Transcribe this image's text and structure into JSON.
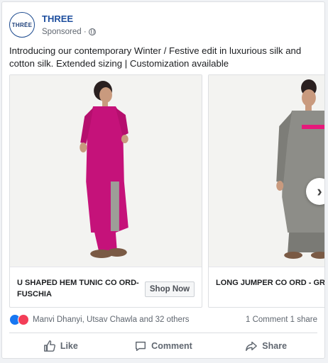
{
  "page": {
    "name": "THREE",
    "avatar_text": "THRĒE",
    "sponsored": "Sponsored ·"
  },
  "post": {
    "text": "Introducing our contemporary Winter / Festive edit in luxurious silk and cotton silk. Extended sizing | Customization available"
  },
  "carousel": {
    "items": [
      {
        "title": "U SHAPED HEM TUNIC CO ORD-FUSCHIA",
        "cta": "Shop Now",
        "dress_color": "#c5127a"
      },
      {
        "title": "LONG JUMPER CO ORD - GREY",
        "dress_color": "#8a8a85"
      }
    ],
    "next": "›"
  },
  "reactions": {
    "names": "Manvi Dhanyi, Utsav Chawla and 32 others",
    "summary": "1 Comment  1 share"
  },
  "actions": {
    "like": "Like",
    "comment": "Comment",
    "share": "Share"
  }
}
